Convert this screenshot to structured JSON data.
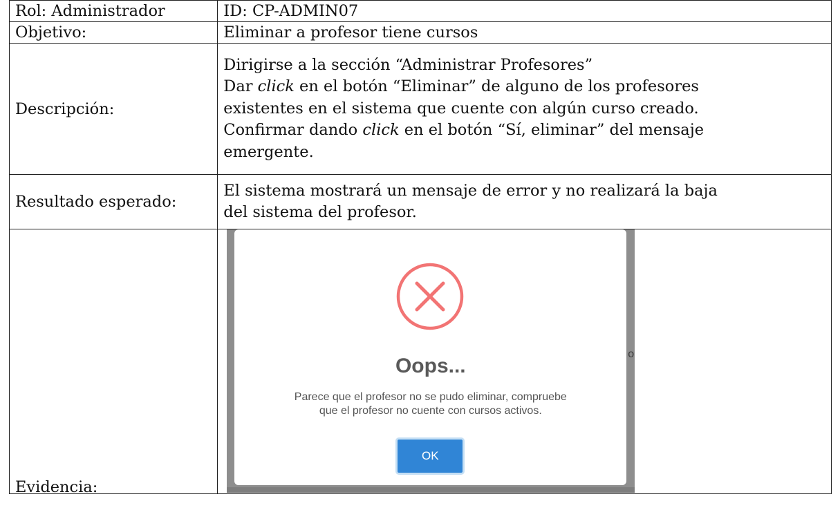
{
  "table": {
    "row1": {
      "left": "Rol: Administrador",
      "right": "ID: CP-ADMIN07"
    },
    "row2": {
      "left": "Objetivo:",
      "right": "Eliminar a profesor tiene cursos"
    },
    "row3": {
      "left": "Descripción:",
      "lines": {
        "l1": "Dirigirse a la sección “Administrar Profesores”",
        "l2_pre": "Dar ",
        "l2_em": "click",
        "l2_post": " en el botón “Eliminar” de alguno de los profesores",
        "l3": "existentes en el sistema que cuente con algún curso creado.",
        "l4_pre": "Confirmar dando ",
        "l4_em": "click",
        "l4_post": " en el botón “Sí, eliminar” del mensaje",
        "l5": "emergente."
      }
    },
    "row4": {
      "left": "Resultado esperado:",
      "lines": {
        "l1": "El sistema mostrará un mensaje de error y no realizará la baja",
        "l2": "del sistema del profesor."
      }
    },
    "row5": {
      "left": "Evidencia:"
    }
  },
  "evidence": {
    "icon": "error-x-circle-icon",
    "icon_color": "#f27474",
    "title": "Oops...",
    "message_line1": "Parece que el profesor no se pudo eliminar, compruebe",
    "message_line2": "que el profesor no cuente con cursos activos.",
    "ok_label": "OK",
    "button_color": "#3085d6",
    "background_partial_text": "o"
  }
}
